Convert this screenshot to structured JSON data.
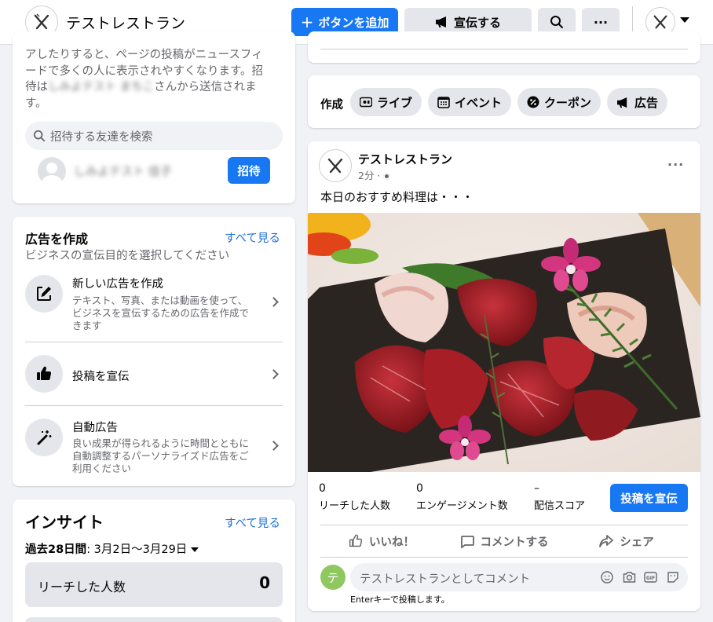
{
  "header": {
    "page_name": "テストレストラン",
    "add_button": "ボタンを追加",
    "promote_button": "宣伝する",
    "more_label": "···"
  },
  "invite": {
    "desc_line1": "アしたりすると、ページの投稿がニュースフィ",
    "desc_line2": "ードで多くの人に表示されやすくなります。招",
    "desc_line3_pre": "待は",
    "desc_line3_blur": "しみよテスト まちこ",
    "desc_line3_post": "さんから送信されま",
    "desc_line4": "す。",
    "search_placeholder": "招待する友達を検索",
    "friend_name": "しみよテスト 佳子",
    "invite_button": "招待"
  },
  "ads": {
    "title": "広告を作成",
    "see_all": "すべて見る",
    "subtitle": "ビジネスの宣伝目的を選択してください",
    "items": [
      {
        "title": "新しい広告を作成",
        "lines": [
          "テキスト、写真、または動画を使って、",
          "ビジネスを宣伝するための広告を作成で",
          "きます"
        ]
      },
      {
        "title": "投稿を宣伝"
      },
      {
        "title": "自動広告",
        "lines": [
          "良い成果が得られるように時間とともに",
          "自動調整するパーソナライズド広告をご",
          "利用ください"
        ]
      }
    ]
  },
  "insights": {
    "title": "インサイト",
    "see_all": "すべて見る",
    "period_label": "過去28日間",
    "period_value": ": 3月2日〜3月29日",
    "reach_label": "リーチした人数",
    "reach_value": "0"
  },
  "composer": {
    "label": "作成",
    "chips": [
      "ライブ",
      "イベント",
      "クーポン",
      "広告"
    ]
  },
  "post": {
    "author": "テストレストラン",
    "time": "2分 ·",
    "text": "本日のおすすめ料理は・・・",
    "stats": [
      {
        "value": "0",
        "label": "リーチした人数"
      },
      {
        "value": "0",
        "label": "エンゲージメント数"
      },
      {
        "value": "–",
        "label": "配信スコア"
      }
    ],
    "promote_button": "投稿を宣伝",
    "actions": [
      "いいね！",
      "コメントする",
      "シェア"
    ],
    "avatar_letter": "テ",
    "comment_placeholder": "テストレストランとしてコメント",
    "enter_hint": "Enterキーで投稿します。"
  },
  "colors": {
    "accent": "#1877f2",
    "avatar_green": "#8fc860"
  }
}
